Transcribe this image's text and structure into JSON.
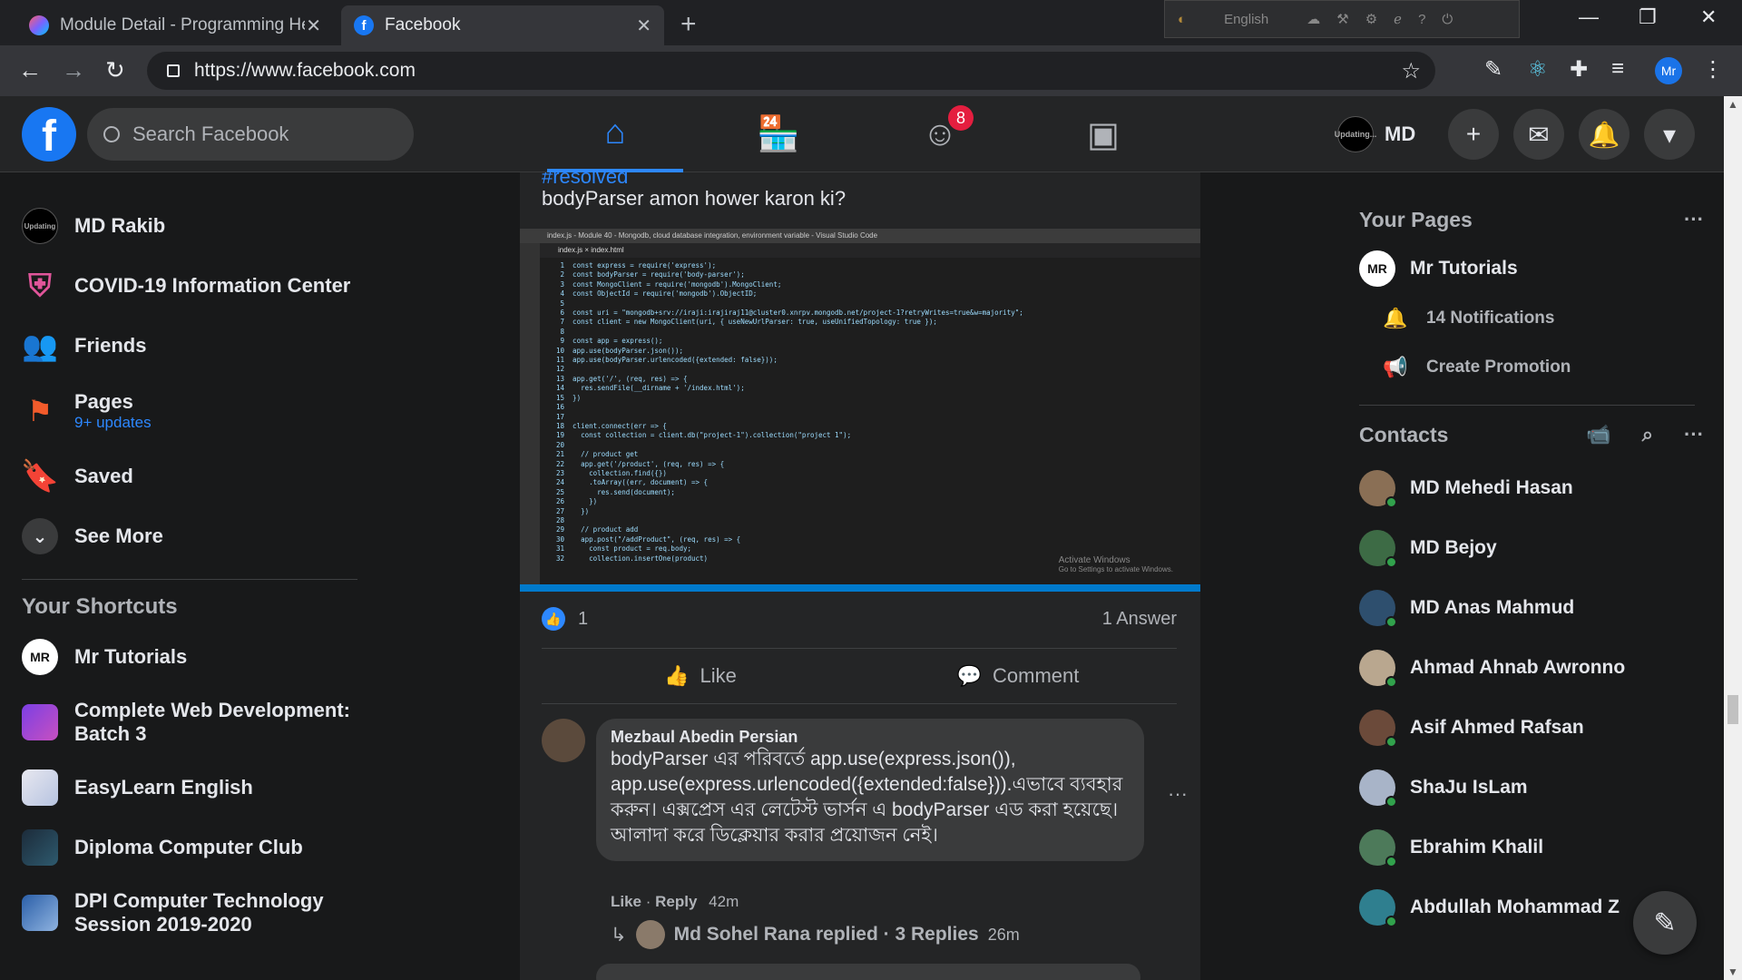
{
  "browser": {
    "tabs": [
      {
        "title": "Module Detail - Programming He",
        "active": false
      },
      {
        "title": "Facebook",
        "active": true
      }
    ],
    "new_tab": "+",
    "url": "https://www.facebook.com",
    "system_language": "English",
    "profile_initials": "Mr"
  },
  "header": {
    "search_placeholder": "Search Facebook",
    "groups_badge": "8",
    "user_name": "MD",
    "user_avatar_text": "Updating..."
  },
  "left_nav": {
    "items": [
      {
        "label": "MD Rakib",
        "sub": "",
        "icon": "avatar"
      },
      {
        "label": "COVID-19 Information Center",
        "sub": "",
        "icon": "covid-shield-icon"
      },
      {
        "label": "Friends",
        "sub": "",
        "icon": "friends-icon"
      },
      {
        "label": "Pages",
        "sub": "9+ updates",
        "icon": "pages-flag-icon"
      },
      {
        "label": "Saved",
        "sub": "",
        "icon": "bookmark-icon"
      },
      {
        "label": "See More",
        "sub": "",
        "icon": "chevron-down-icon"
      }
    ],
    "shortcuts_title": "Your Shortcuts",
    "shortcuts": [
      {
        "label": "Mr Tutorials",
        "line2": ""
      },
      {
        "label": "Complete Web Development:",
        "line2": "Batch 3"
      },
      {
        "label": "EasyLearn English",
        "line2": ""
      },
      {
        "label": "Diploma Computer Club",
        "line2": ""
      },
      {
        "label": "DPI Computer Technology",
        "line2": "Session 2019-2020"
      }
    ]
  },
  "post": {
    "tag": "#resolved",
    "question": "bodyParser amon hower karon ki?",
    "code_lines": [
      "const express = require('express');",
      "const bodyParser = require('body-parser');",
      "const MongoClient = require('mongodb').MongoClient;",
      "const ObjectId = require('mongodb').ObjectID;",
      "",
      "const uri = \"mongodb+srv://iraji:irajiraj11@cluster0.xnrpv.mongodb.net/project-1?retryWrites=true&w=majority\";",
      "const client = new MongoClient(uri, { useNewUrlParser: true, useUnifiedTopology: true });",
      "",
      "const app = express();",
      "app.use(bodyParser.json());",
      "app.use(bodyParser.urlencoded({extended: false}));",
      "",
      "app.get('/', (req, res) => {",
      "  res.sendFile(__dirname + '/index.html');",
      "})",
      "",
      "",
      "client.connect(err => {",
      "  const collection = client.db(\"project-1\").collection(\"project 1\");",
      "",
      "  // product get",
      "  app.get('/product', (req, res) => {",
      "    collection.find({})",
      "    .toArray((err, document) => {",
      "      res.send(document);",
      "    })",
      "  })",
      "",
      "  // product add",
      "  app.post(\"/addProduct\", (req, res) => {",
      "    const product = req.body;",
      "    collection.insertOne(product)"
    ],
    "editor_title": "index.js - Module 40 - Mongodb, cloud database integration, environment variable - Visual Studio Code",
    "editor_tabs": "index.js   ×   index.html",
    "watermark_line1": "Activate Windows",
    "watermark_line2": "Go to Settings to activate Windows.",
    "like_count": "1",
    "answers": "1 Answer",
    "like_label": "Like",
    "comment_label": "Comment",
    "comment": {
      "author": "Mezbaul Abedin Persian",
      "text": "bodyParser এর পরিবর্তে app.use(express.json()), app.use(express.urlencoded({extended:false})).এভাবে ব্যবহার করুন। এক্সপ্রেস এর লেটেস্ট ভার্সন এ bodyParser এড করা হয়েছে। আলাদা করে ডিক্লেয়ার করার প্রয়োজন নেই।",
      "like": "Like",
      "reply": "Reply",
      "time": "42m",
      "replies_text": "Md Sohel Rana replied · 3 Replies",
      "replies_time": "26m"
    }
  },
  "right": {
    "pages_title": "Your Pages",
    "page_name": "Mr Tutorials",
    "notifications": "14 Notifications",
    "promotion": "Create Promotion",
    "contacts_title": "Contacts",
    "contacts": [
      "MD Mehedi Hasan",
      "MD Bejoy",
      "MD Anas Mahmud",
      "Ahmad Ahnab Awronno",
      "Asif Ahmed Rafsan",
      "ShaJu IsLam",
      "Ebrahim Khalil",
      "Abdullah Mohammad Z"
    ]
  },
  "colors": {
    "accent": "#2d88ff",
    "brand": "#1877f2",
    "online": "#31a24c",
    "badge": "#e41e3f"
  }
}
